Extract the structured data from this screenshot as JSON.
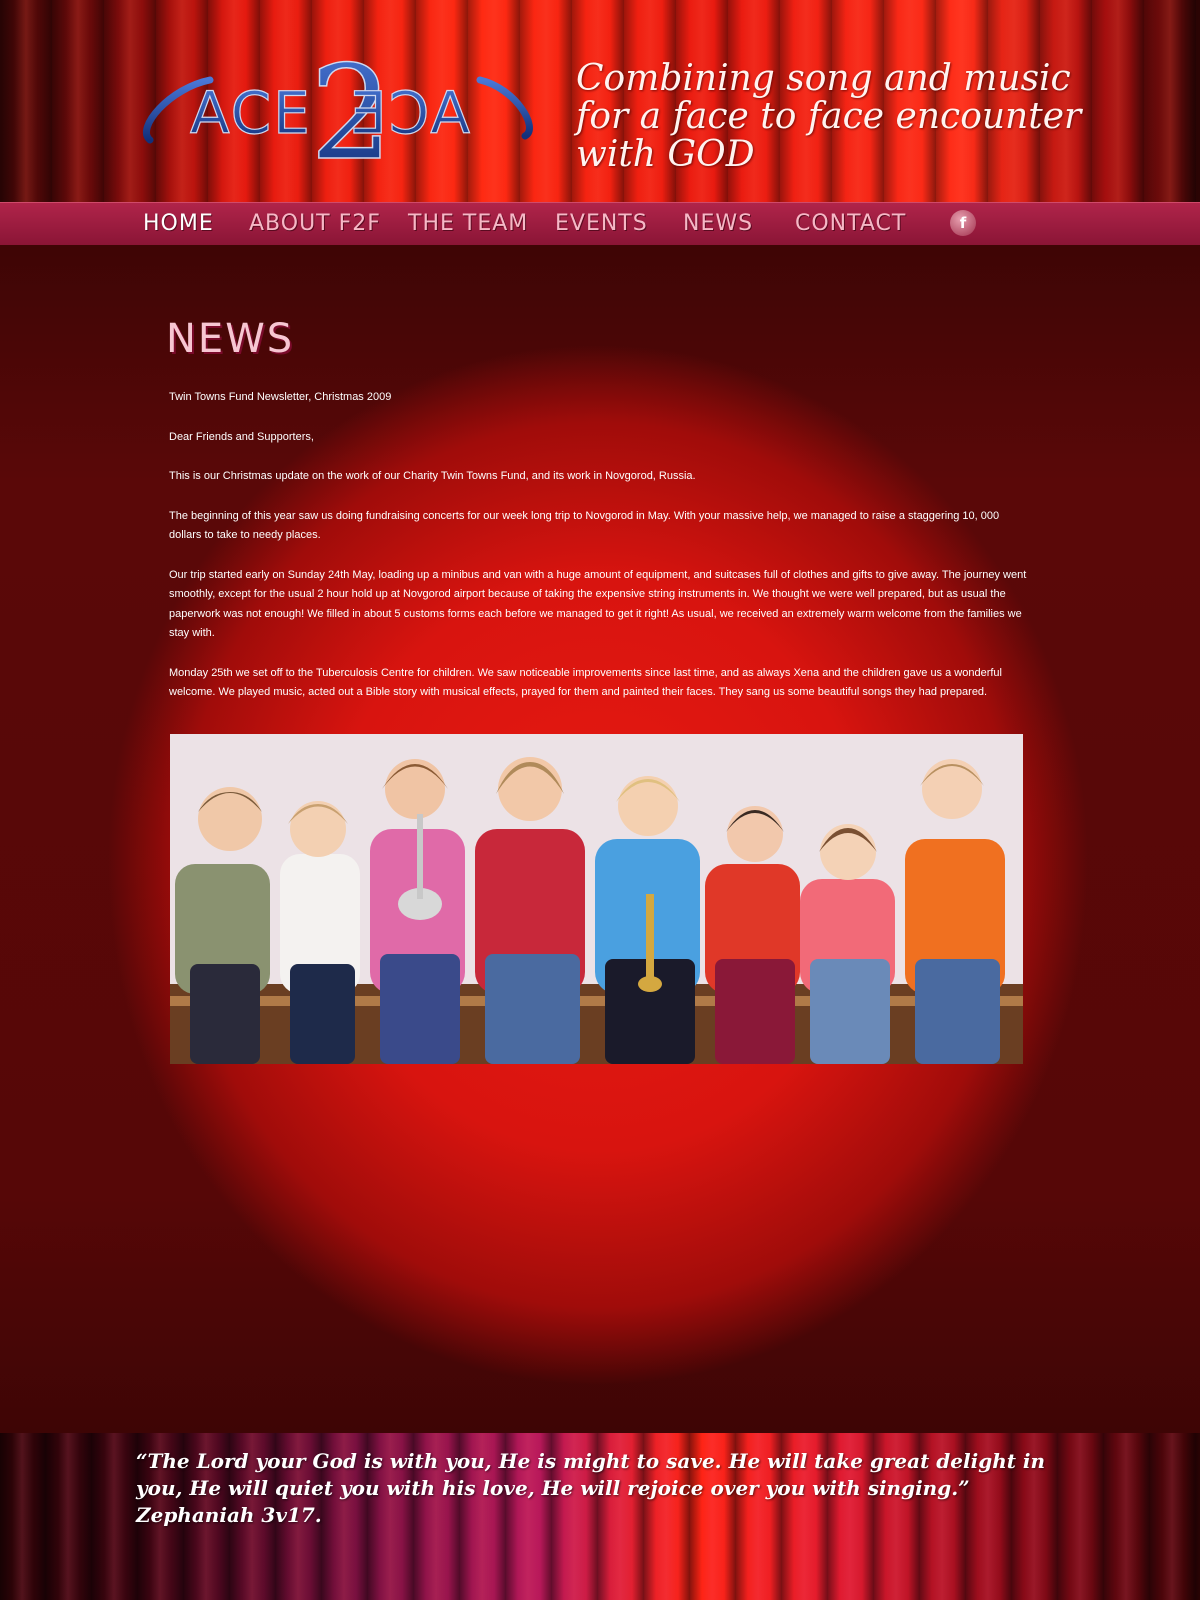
{
  "header": {
    "logo_text": "FACE2FACE",
    "tagline": "Combining song and music for a face to face encounter with GOD"
  },
  "nav": {
    "items": [
      {
        "label": "HOME",
        "active": true
      },
      {
        "label": "ABOUT F2F",
        "active": false
      },
      {
        "label": "THE TEAM",
        "active": false
      },
      {
        "label": "EVENTS",
        "active": false
      },
      {
        "label": "NEWS",
        "active": false
      },
      {
        "label": "CONTACT",
        "active": false
      }
    ],
    "facebook_icon": "f"
  },
  "main": {
    "page_title": "NEWS",
    "paragraphs": [
      "Twin Towns Fund Newsletter, Christmas 2009",
      "Dear Friends and Supporters,",
      "This is our Christmas update on the work of our Charity Twin Towns Fund, and its work in Novgorod, Russia.",
      "The beginning of this year saw us doing fundraising concerts for our week long trip to Novgorod in May. With your massive help, we managed to raise a staggering 10, 000 dollars to take to needy places.",
      "Our trip started early on Sunday 24th May, loading up a minibus and van with a huge amount of equipment, and suitcases full of clothes and gifts to give away. The journey went smoothly, except for the usual 2 hour hold up at Novgorod airport because of taking the expensive string instruments in. We thought we were well prepared, but as usual the paperwork was not enough! We filled in about 5 customs forms each before we managed to get it right! As usual, we received an extremely warm welcome from the families we stay with.",
      "Monday 25th we set off to the Tuberculosis Centre for children. We saw noticeable improvements since last time, and as always Xena and the children gave us a wonderful welcome. We played music, acted out a Bible story with musical effects, prayed for them and painted their faces. They sang us some beautiful songs they had prepared."
    ]
  },
  "footer": {
    "quote": "“The Lord your God is with you, He is might to save. He will take great delight in you, He will quiet you with his love, He will rejoice over you with singing.” Zephaniah 3v17."
  },
  "colors": {
    "nav_bar": "#9a1a40",
    "nav_text": "#f6b8c6",
    "spotlight": "#e81a12",
    "logo_blue": "#1f4aa8"
  }
}
